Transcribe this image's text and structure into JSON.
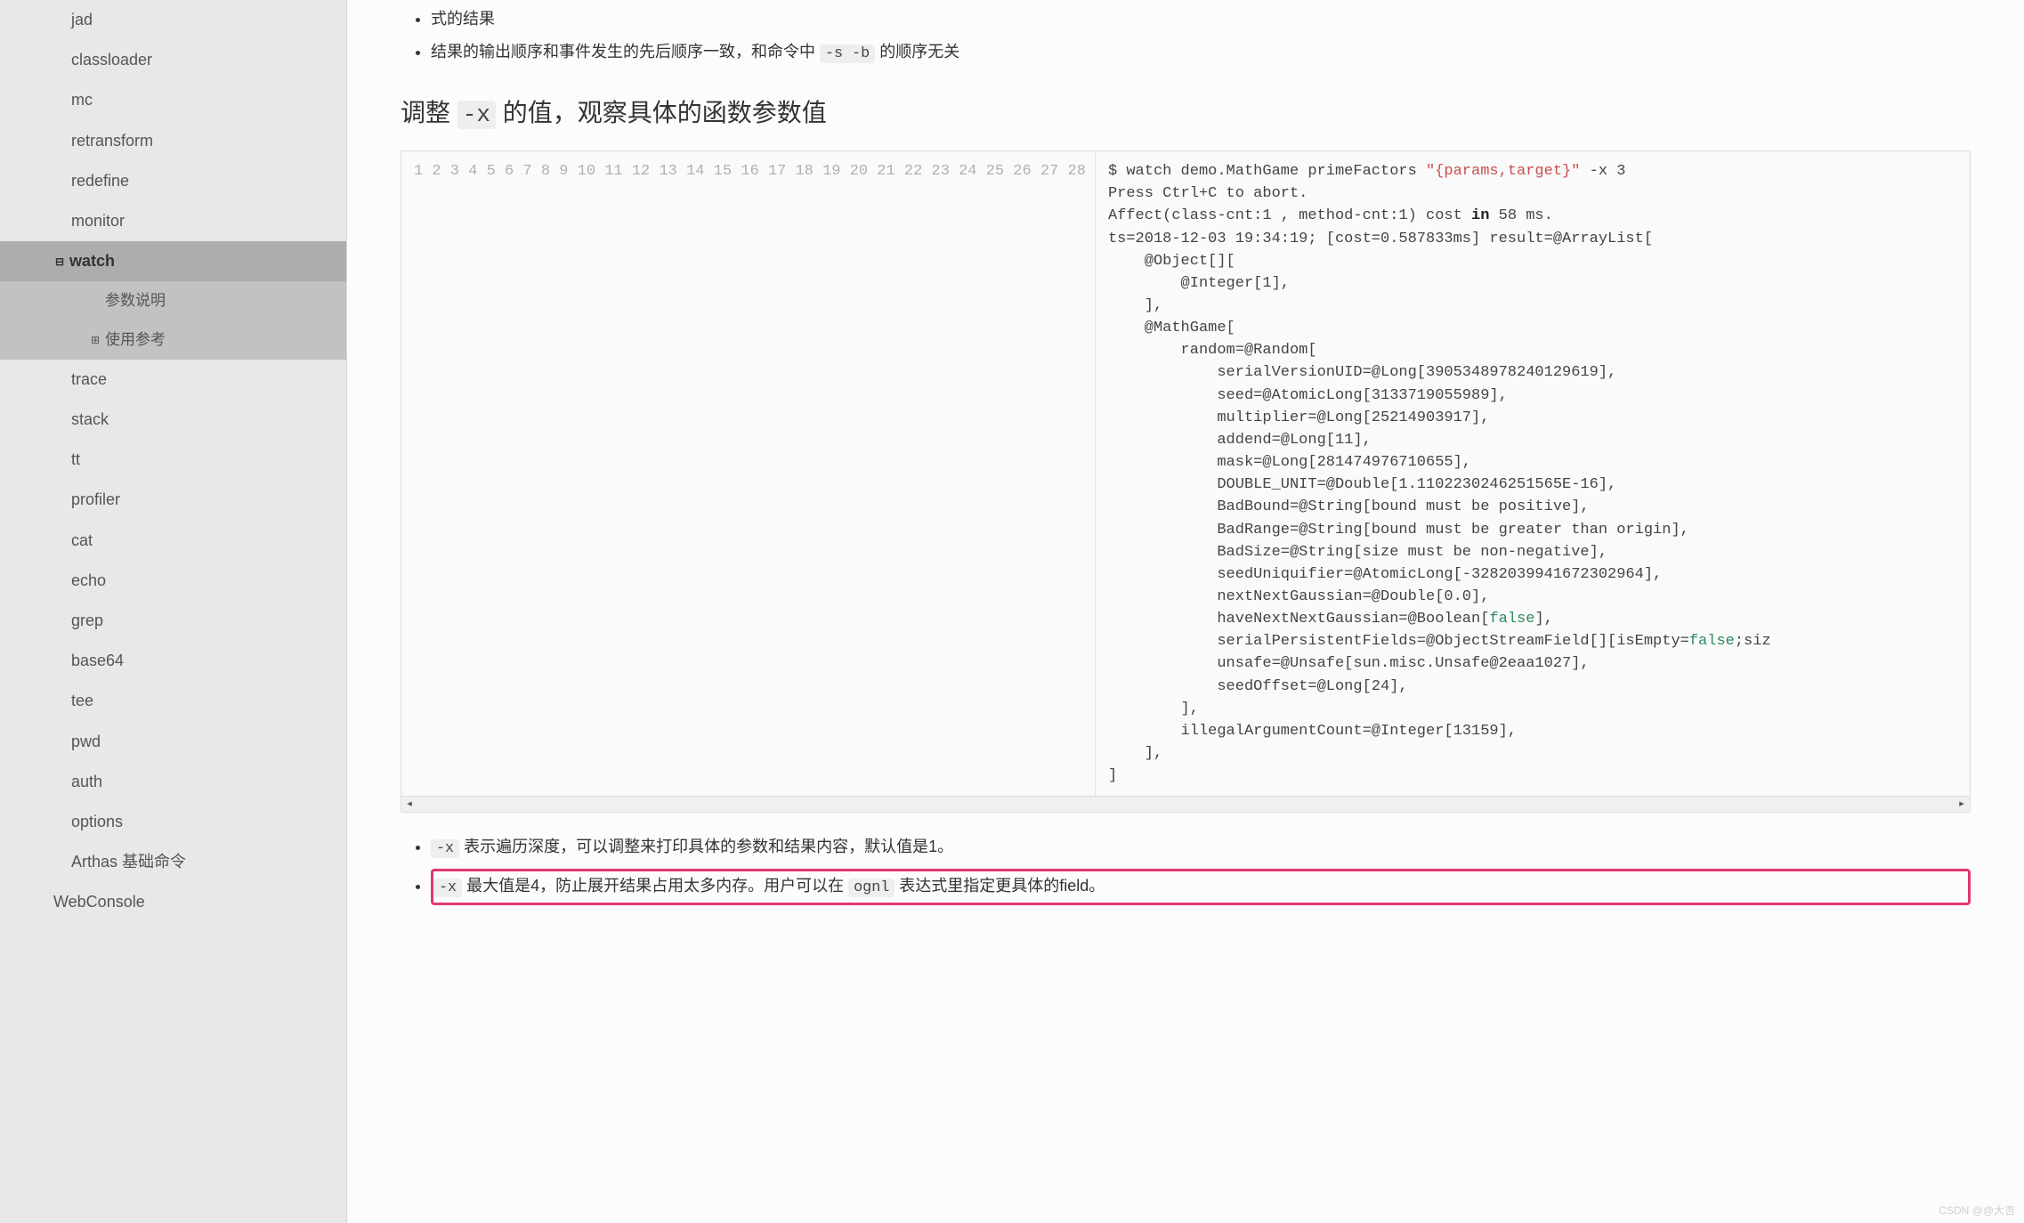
{
  "sidebar": {
    "items": [
      {
        "label": "jad",
        "level": 2,
        "sel": false
      },
      {
        "label": "classloader",
        "level": 2,
        "sel": false
      },
      {
        "label": "mc",
        "level": 2,
        "sel": false
      },
      {
        "label": "retransform",
        "level": 2,
        "sel": false
      },
      {
        "label": "redefine",
        "level": 2,
        "sel": false
      },
      {
        "label": "monitor",
        "level": 2,
        "sel": false
      }
    ],
    "selected": {
      "marker": "⊟",
      "label": "watch"
    },
    "subitems": [
      {
        "marker": "",
        "label": "参数说明"
      },
      {
        "marker": "⊞",
        "label": "使用参考"
      }
    ],
    "items_after": [
      {
        "label": "trace"
      },
      {
        "label": "stack"
      },
      {
        "label": "tt"
      },
      {
        "label": "profiler"
      },
      {
        "label": "cat"
      },
      {
        "label": "echo"
      },
      {
        "label": "grep"
      },
      {
        "label": "base64"
      },
      {
        "label": "tee"
      },
      {
        "label": "pwd"
      },
      {
        "label": "auth"
      },
      {
        "label": "options"
      },
      {
        "label": "Arthas 基础命令"
      }
    ],
    "bottom": {
      "label": "WebConsole"
    }
  },
  "content": {
    "intro_tail": "式的结果",
    "bullet1_a": "结果的输出顺序和事件发生的先后顺序一致，和命令中 ",
    "bullet1_code": "-s -b",
    "bullet1_b": " 的顺序无关",
    "section_a": "调整 ",
    "section_code": "-x",
    "section_b": " 的值，观察具体的函数参数值",
    "code": {
      "line_count": 28,
      "l1_a": "$ watch demo.MathGame primeFactors ",
      "l1_str": "\"{params,target}\"",
      "l1_b": " -x 3",
      "l2": "Press Ctrl+C to abort.",
      "l3_a": "Affect(class-cnt:1 , method-cnt:1) cost ",
      "l3_kw": "in",
      "l3_b": " 58 ms.",
      "l4": "ts=2018-12-03 19:34:19; [cost=0.587833ms] result=@ArrayList[",
      "l5": "    @Object[][",
      "l6": "        @Integer[1],",
      "l7": "    ],",
      "l8": "    @MathGame[",
      "l9": "        random=@Random[",
      "l10": "            serialVersionUID=@Long[3905348978240129619],",
      "l11": "            seed=@AtomicLong[3133719055989],",
      "l12": "            multiplier=@Long[25214903917],",
      "l13": "            addend=@Long[11],",
      "l14": "            mask=@Long[281474976710655],",
      "l15": "            DOUBLE_UNIT=@Double[1.1102230246251565E-16],",
      "l16": "            BadBound=@String[bound must be positive],",
      "l17": "            BadRange=@String[bound must be greater than origin],",
      "l18": "            BadSize=@String[size must be non-negative],",
      "l19": "            seedUniquifier=@AtomicLong[-3282039941672302964],",
      "l20": "            nextNextGaussian=@Double[0.0],",
      "l21_a": "            haveNextNextGaussian=@Boolean[",
      "l21_bool": "false",
      "l21_b": "],",
      "l22_a": "            serialPersistentFields=@ObjectStreamField[][isEmpty=",
      "l22_bool": "false",
      "l22_b": ";siz",
      "l23": "            unsafe=@Unsafe[sun.misc.Unsafe@2eaa1027],",
      "l24": "            seedOffset=@Long[24],",
      "l25": "        ],",
      "l26": "        illegalArgumentCount=@Integer[13159],",
      "l27": "    ],",
      "l28": "]"
    },
    "note1_code": "-x",
    "note1_text": " 表示遍历深度，可以调整来打印具体的参数和结果内容，默认值是1。",
    "note2_code1": "-x",
    "note2_mid": " 最大值是4，防止展开结果占用太多内存。用户可以在 ",
    "note2_code2": "ognl",
    "note2_tail": " 表达式里指定更具体的field。"
  },
  "watermark": "CSDN @@大吉"
}
